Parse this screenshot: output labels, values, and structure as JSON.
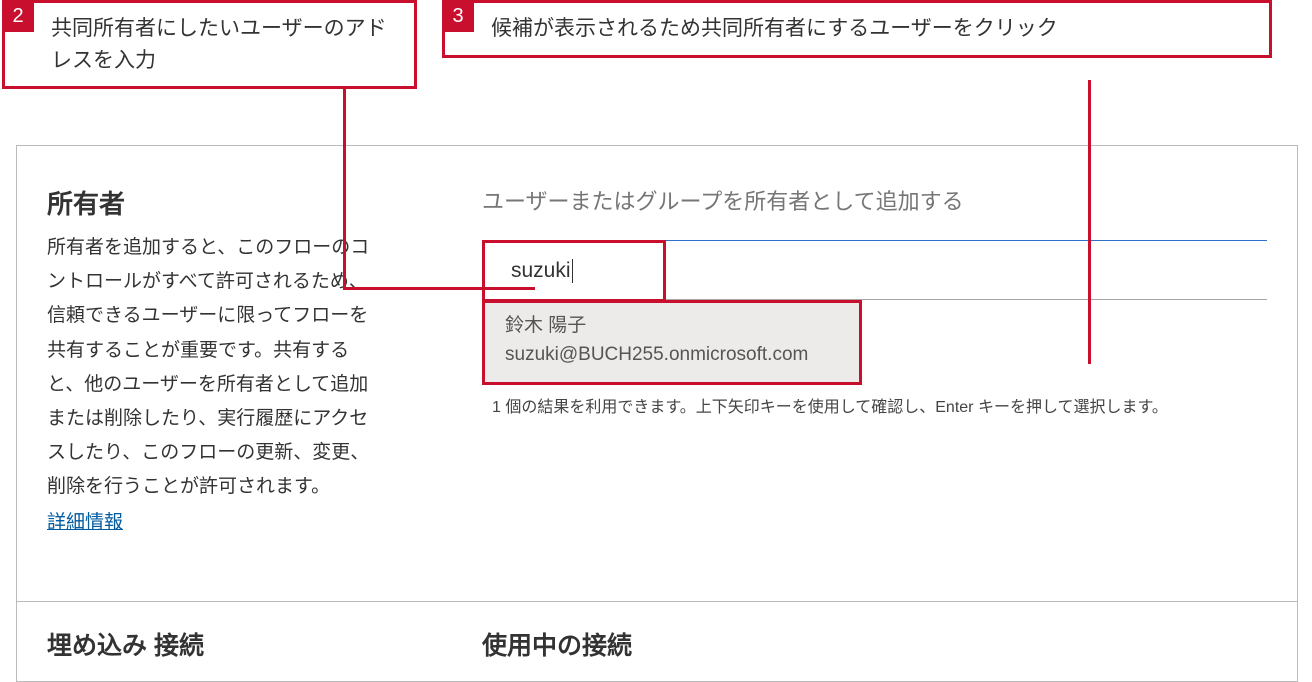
{
  "callouts": {
    "step2": {
      "num": "2",
      "text": "共同所有者にしたいユーザーのアドレスを入力"
    },
    "step3": {
      "num": "3",
      "text": "候補が表示されるため共同所有者にするユーザーをクリック"
    }
  },
  "owners": {
    "title": "所有者",
    "description": "所有者を追加すると、このフローのコントロールがすべて許可されるため、信頼できるユーザーに限ってフローを共有することが重要です。共有すると、他のユーザーを所有者として追加または削除したり、実行履歴にアクセスしたり、このフローの更新、変更、削除を行うことが許可されます。",
    "learn_more": "詳細情報"
  },
  "add_owners": {
    "label": "ユーザーまたはグループを所有者として追加する",
    "typed": "suzuki",
    "suggestion": {
      "name": "鈴木 陽子",
      "email": "suzuki@BUCH255.onmicrosoft.com"
    },
    "result_hint": "1 個の結果を利用できます。上下矢印キーを使用して確認し、Enter キーを押して選択します。"
  },
  "bottom": {
    "embed": "埋め込み 接続",
    "in_use": "使用中の接続"
  }
}
